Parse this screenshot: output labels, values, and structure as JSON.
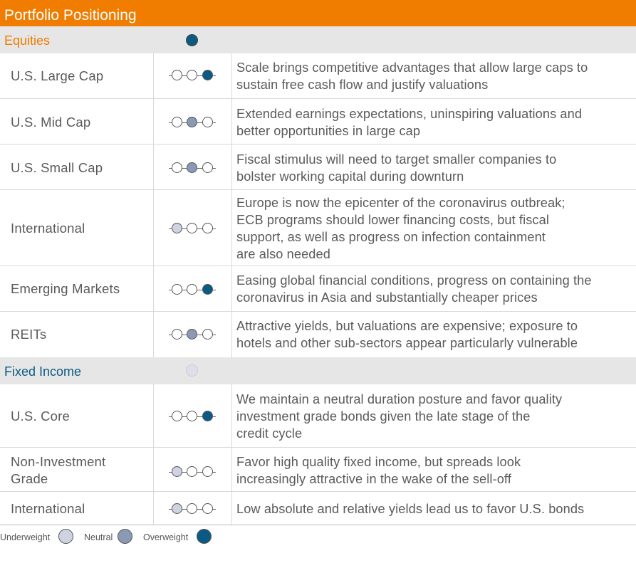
{
  "title": "Portfolio Positioning",
  "colors": {
    "header": "#f07c00",
    "underweight": "#cfd3e0",
    "neutral": "#8a9ab5",
    "overweight": "#0b5a83",
    "equities_label": "#f07c00",
    "fixed_income_label": "#0b5a83"
  },
  "sections": [
    {
      "label": "Equities",
      "marker": "overweight",
      "rows": [
        {
          "name": "U.S. Large Cap",
          "position": "overweight",
          "description": "Scale brings competitive advantages that allow large caps to\nsustain free cash flow and justify valuations"
        },
        {
          "name": "U.S. Mid Cap",
          "position": "neutral",
          "description": "Extended earnings expectations, uninspiring valuations and\nbetter opportunities in large cap"
        },
        {
          "name": "U.S. Small Cap",
          "position": "neutral",
          "description": "Fiscal stimulus will need to target smaller companies to\nbolster working capital during downturn"
        },
        {
          "name": "International",
          "position": "underweight",
          "description": "Europe is now the epicenter of the coronavirus outbreak;\nECB programs should lower financing costs, but fiscal\nsupport, as well as progress on infection containment\nare also needed"
        },
        {
          "name": "Emerging Markets",
          "position": "overweight",
          "description": "Easing global financial conditions, progress on containing the\ncoronavirus in Asia and substantially cheaper prices"
        },
        {
          "name": "REITs",
          "position": "neutral",
          "description": "Attractive yields, but valuations are expensive; exposure to\nhotels and other sub-sectors appear particularly vulnerable"
        }
      ]
    },
    {
      "label": "Fixed Income",
      "marker": "underweight",
      "rows": [
        {
          "name": "U.S. Core",
          "position": "overweight",
          "description": "We maintain a neutral duration posture and favor quality\ninvestment grade bonds given the late stage of the\ncredit cycle"
        },
        {
          "name": "Non-Investment\nGrade",
          "position": "underweight",
          "description": "Favor high quality fixed income, but spreads look\nincreasingly attractive in the wake of the sell-off"
        },
        {
          "name": "International",
          "position": "underweight",
          "description": "Low absolute and relative yields lead us to favor U.S. bonds"
        }
      ]
    }
  ],
  "legend": [
    {
      "label": "Underweight",
      "position": "underweight"
    },
    {
      "label": "Neutral",
      "position": "neutral"
    },
    {
      "label": "Overweight",
      "position": "overweight"
    }
  ]
}
